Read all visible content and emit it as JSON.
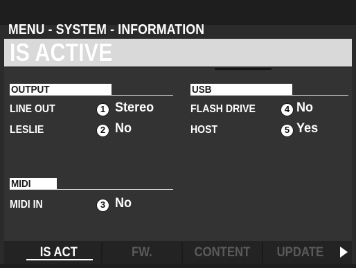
{
  "header": {
    "menu_path": "MENU - SYSTEM - INFORMATION",
    "page_title": "IS ACTIVE"
  },
  "output": {
    "heading": "OUTPUT",
    "rows": [
      {
        "label": "LINE OUT",
        "callout": "1",
        "value": "Stereo"
      },
      {
        "label": "LESLIE",
        "callout": "2",
        "value": "No"
      }
    ]
  },
  "usb": {
    "heading": "USB",
    "rows": [
      {
        "label": "FLASH DRIVE",
        "callout": "4",
        "value": "No"
      },
      {
        "label": "HOST",
        "callout": "5",
        "value": "Yes"
      }
    ]
  },
  "midi": {
    "heading": "MIDI",
    "rows": [
      {
        "label": "MIDI IN",
        "callout": "3",
        "value": "No"
      }
    ]
  },
  "tabs": [
    {
      "label": "IS ACT",
      "active": true
    },
    {
      "label": "FW.",
      "active": false
    },
    {
      "label": "CONTENT",
      "active": false
    },
    {
      "label": "UPDATE",
      "active": false
    }
  ],
  "icons": {
    "next_page": "right-arrow-icon"
  },
  "colors": {
    "lcd_background": "#2b2b2b",
    "title_band": "#d9d9d9",
    "text": "#ffffff",
    "inactive_tab": "#5a5a5a"
  }
}
